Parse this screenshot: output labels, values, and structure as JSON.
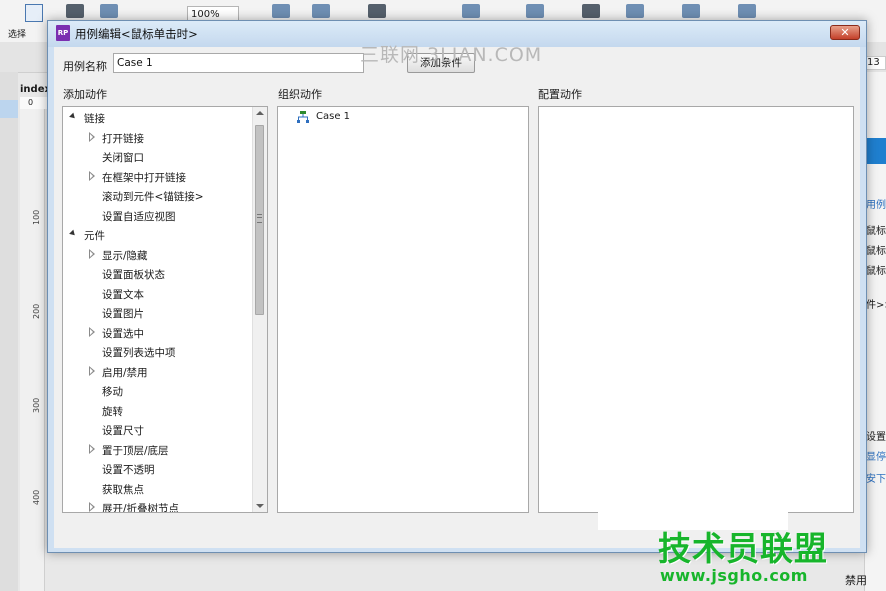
{
  "app": {
    "toolbar_select_label": "选择",
    "zoom_value": "100%",
    "page_tab": "index",
    "top_ruler_zero": "0",
    "ruler_marks": [
      "100",
      "200",
      "300",
      "400"
    ],
    "right_field_value": "13",
    "right_panel_texts": [
      "用例",
      "鼠标",
      "鼠标",
      "鼠标",
      "件>>",
      "设置",
      "显停",
      "安下"
    ],
    "bottom_right_text": "禁用"
  },
  "dialog": {
    "title": "用例编辑<鼠标单击时>",
    "logo_text": "RP",
    "close_glyph": "✕",
    "case_name_label": "用例名称",
    "case_name_value": "Case 1",
    "add_condition_label": "添加条件",
    "columns": {
      "add_actions": "添加动作",
      "organize_actions": "组织动作",
      "configure_actions": "配置动作"
    },
    "action_tree": [
      {
        "label": "链接",
        "level": 0,
        "expander": "expanded"
      },
      {
        "label": "打开链接",
        "level": 1,
        "expander": "collapsed"
      },
      {
        "label": "关闭窗口",
        "level": 1,
        "expander": "none"
      },
      {
        "label": "在框架中打开链接",
        "level": 1,
        "expander": "collapsed"
      },
      {
        "label": "滚动到元件<锚链接>",
        "level": 1,
        "expander": "none"
      },
      {
        "label": "设置自适应视图",
        "level": 1,
        "expander": "none"
      },
      {
        "label": "元件",
        "level": 0,
        "expander": "expanded"
      },
      {
        "label": "显示/隐藏",
        "level": 1,
        "expander": "collapsed"
      },
      {
        "label": "设置面板状态",
        "level": 1,
        "expander": "none"
      },
      {
        "label": "设置文本",
        "level": 1,
        "expander": "none"
      },
      {
        "label": "设置图片",
        "level": 1,
        "expander": "none"
      },
      {
        "label": "设置选中",
        "level": 1,
        "expander": "collapsed"
      },
      {
        "label": "设置列表选中项",
        "level": 1,
        "expander": "none"
      },
      {
        "label": "启用/禁用",
        "level": 1,
        "expander": "collapsed"
      },
      {
        "label": "移动",
        "level": 1,
        "expander": "none"
      },
      {
        "label": "旋转",
        "level": 1,
        "expander": "none"
      },
      {
        "label": "设置尺寸",
        "level": 1,
        "expander": "none"
      },
      {
        "label": "置于顶层/底层",
        "level": 1,
        "expander": "collapsed"
      },
      {
        "label": "设置不透明",
        "level": 1,
        "expander": "none"
      },
      {
        "label": "获取焦点",
        "level": 1,
        "expander": "none"
      },
      {
        "label": "展开/折叠树节点",
        "level": 1,
        "expander": "collapsed"
      }
    ],
    "organize_items": [
      {
        "label": "Case 1",
        "icon": "case-tree-icon"
      }
    ]
  },
  "watermarks": {
    "top": "三联网 3LIAN.COM",
    "brand": "技术员联盟",
    "url": "www.jsgho.com"
  },
  "colors": {
    "dialog_frame": "#cfe0f2",
    "close_button": "#c4402a",
    "rp_logo": "#7b2fb0",
    "watermark_green": "#17b52b",
    "selection_blue": "#1f7fcf"
  }
}
